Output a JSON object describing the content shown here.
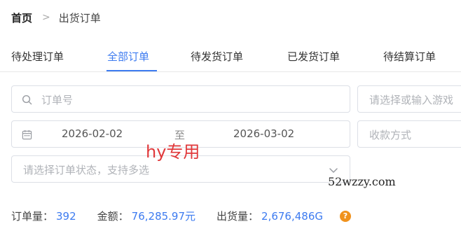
{
  "breadcrumb": {
    "home": "首页",
    "separator": ">",
    "current": "出货订单"
  },
  "tabs": [
    {
      "label": "待处理订单",
      "active": false
    },
    {
      "label": "全部订单",
      "active": true
    },
    {
      "label": "待发货订单",
      "active": false
    },
    {
      "label": "已发货订单",
      "active": false
    },
    {
      "label": "待结算订单",
      "active": false
    }
  ],
  "filters": {
    "order_no_placeholder": "订单号",
    "game_placeholder": "请选择或输入游戏",
    "date_start": "2026-02-02",
    "date_separator": "至",
    "date_end": "2026-03-02",
    "payment_placeholder": "收款方式",
    "status_placeholder": "请选择订单状态，支持多选"
  },
  "stats": {
    "order_count_label": "订单量：",
    "order_count": "392",
    "amount_label": "金额：",
    "amount": "76,285.97元",
    "shipment_label": "出货量：",
    "shipment": "2,676,486G",
    "help_icon": "?"
  },
  "overlays": {
    "watermark": "hy专用",
    "site_stamp": "52wzzy.com"
  },
  "colors": {
    "accent": "#3d7bf0",
    "watermark": "#e0383a",
    "help": "#f0921d"
  }
}
